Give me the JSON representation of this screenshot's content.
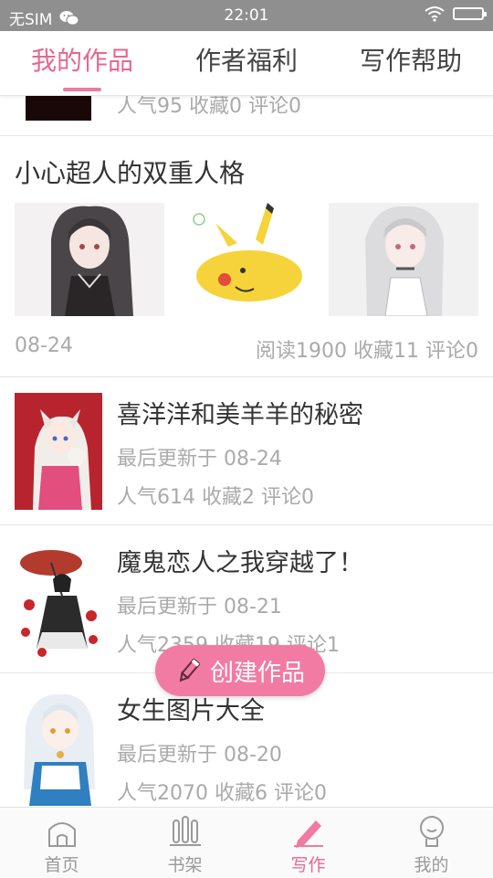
{
  "status_bar": {
    "carrier": "无SIM",
    "time": "22:01",
    "icons": [
      "wechat-icon",
      "wifi-icon",
      "battery-icon"
    ]
  },
  "top_tabs": [
    {
      "label": "我的作品",
      "active": true
    },
    {
      "label": "作者福利",
      "active": false
    },
    {
      "label": "写作帮助",
      "active": false
    }
  ],
  "partial_item": {
    "stats": "人气95 收藏0 评论0"
  },
  "album_item": {
    "title": "小心超人的双重人格",
    "date": "08-24",
    "stats": "阅读1900 收藏11 评论0",
    "images": [
      "dark-haired-girl-illustration",
      "pikachu-illustration",
      "silver-haired-girl-illustration"
    ]
  },
  "works": [
    {
      "title": "喜洋洋和美羊羊的秘密",
      "updated": "最后更新于 08-24",
      "stats": "人气614 收藏2 评论0"
    },
    {
      "title": "魔鬼恋人之我穿越了！",
      "updated": "最后更新于 08-21",
      "stats": "人气2359 收藏19 评论1"
    },
    {
      "title": "女生图片大全",
      "updated": "最后更新于 08-20",
      "stats": "人气2070 收藏6 评论0"
    }
  ],
  "create_button": {
    "label": "创建作品",
    "icon": "pencil-icon"
  },
  "bottom_nav": [
    {
      "label": "首页",
      "icon": "home-icon",
      "active": false
    },
    {
      "label": "书架",
      "icon": "bookshelf-icon",
      "active": false
    },
    {
      "label": "写作",
      "icon": "pen-icon",
      "active": true
    },
    {
      "label": "我的",
      "icon": "profile-icon",
      "active": false
    }
  ],
  "colors": {
    "accent": "#e8678f",
    "button": "#f27ba3",
    "status_bar": "#8f8f8f",
    "muted_text": "#aaaaaa"
  }
}
